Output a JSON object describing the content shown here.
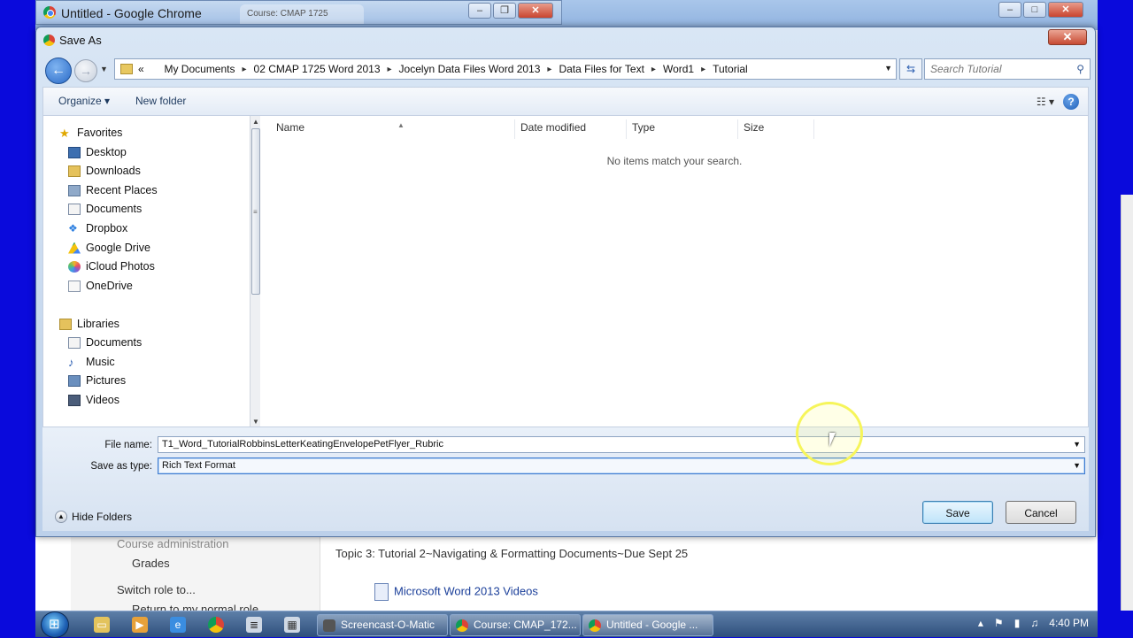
{
  "browser": {
    "title": "Untitled - Google Chrome",
    "bg_tab": "Course: CMAP 1725"
  },
  "dialog": {
    "title": "Save As",
    "close_label": "✕",
    "breadcrumbs": [
      "My Documents",
      "02 CMAP 1725 Word 2013",
      "Jocelyn Data Files Word 2013",
      "Data Files for Text",
      "Word1",
      "Tutorial"
    ],
    "breadcrumb_overflow": "«",
    "search_placeholder": "Search Tutorial",
    "toolbar": {
      "organize": "Organize ▾",
      "new_folder": "New folder"
    },
    "nav": {
      "favorites": "Favorites",
      "favorite_items": [
        "Desktop",
        "Downloads",
        "Recent Places",
        "Documents",
        "Dropbox",
        "Google Drive",
        "iCloud Photos",
        "OneDrive"
      ],
      "libraries": "Libraries",
      "library_items": [
        "Documents",
        "Music",
        "Pictures",
        "Videos"
      ]
    },
    "columns": [
      "Name",
      "Date modified",
      "Type",
      "Size"
    ],
    "empty_message": "No items match your search.",
    "file_name_label": "File name:",
    "file_name_value": "T1_Word_TutorialRobbinsLetterKeatingEnvelopePetFlyer_Rubric",
    "save_type_label": "Save as type:",
    "save_type_value": "Rich Text Format",
    "hide_folders": "Hide Folders",
    "save_button": "Save",
    "cancel_button": "Cancel"
  },
  "background_page": {
    "course_admin": "Course administration",
    "grades": "Grades",
    "switch_role": "Switch role to...",
    "return_role": "Return to my normal role",
    "topic": "Topic 3: Tutorial 2~Navigating & Formatting Documents~Due Sept 25",
    "link": "Microsoft Word 2013 Videos"
  },
  "taskbar": {
    "tasks": [
      "Screencast-O-Matic",
      "Course: CMAP_172...",
      "Untitled - Google ..."
    ],
    "clock": "4:40 PM"
  },
  "colors": {
    "desktop_blue": "#0a0adc",
    "dialog_frame": "#bcd0ea",
    "cursor_highlight": "#f6f55a"
  }
}
